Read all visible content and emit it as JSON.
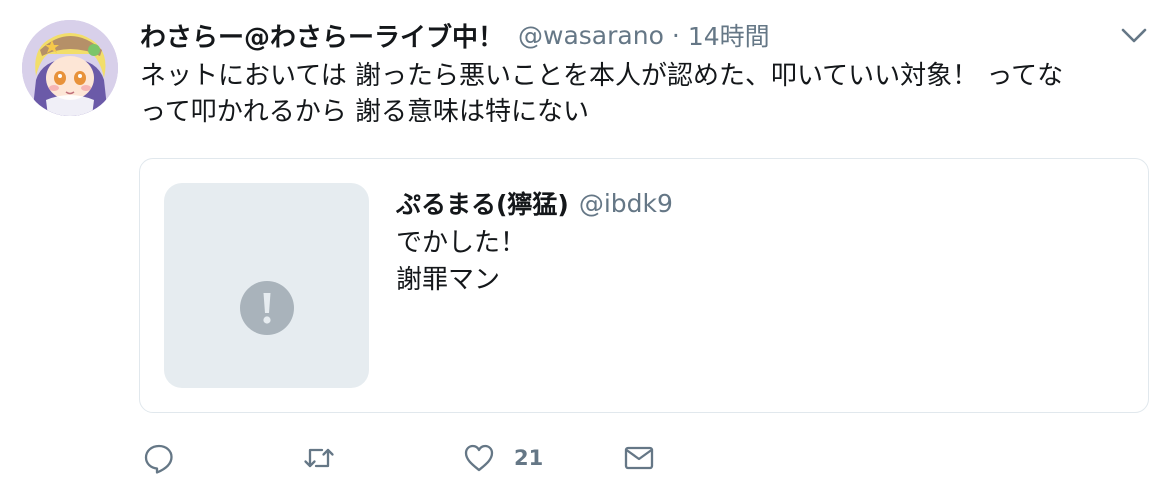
{
  "tweet": {
    "display_name": "わさらー@わさらーライブ中！",
    "handle": "@wasarano",
    "separator": "·",
    "time": "14時間",
    "text_lines": [
      "ネットにおいては 謝ったら悪いことを本人が認めた、叩いていい対象！ ってな",
      "って叩かれるから 謝る意味は特にない"
    ]
  },
  "quoted": {
    "display_name": "ぷるまる(獰猛)",
    "handle": "@ibdk9",
    "text_lines": [
      "でかした！",
      "謝罪マン"
    ],
    "media_icon": "alert-circle-icon"
  },
  "actions": {
    "reply_icon": "reply-icon",
    "retweet_icon": "retweet-icon",
    "like_icon": "heart-icon",
    "like_count": "21",
    "dm_icon": "envelope-icon"
  },
  "colors": {
    "text": "#14171a",
    "secondary": "#657786",
    "border": "#e1e8ed",
    "media_bg": "#e6ecf0",
    "media_icon": "#a9b3bb"
  }
}
